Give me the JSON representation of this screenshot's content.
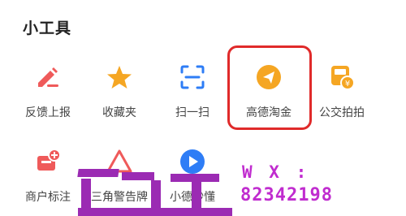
{
  "section": {
    "title": "小工具"
  },
  "tools": [
    {
      "label": "反馈上报",
      "icon": "feedback-pencil-icon"
    },
    {
      "label": "收藏夹",
      "icon": "star-icon"
    },
    {
      "label": "扫一扫",
      "icon": "scan-icon"
    },
    {
      "label": "高德淘金",
      "icon": "gold-send-icon"
    },
    {
      "label": "公交拍拍",
      "icon": "bus-camera-icon"
    },
    {
      "label": "商户标注",
      "icon": "merchant-mark-icon"
    },
    {
      "label": "三角警告牌",
      "icon": "warning-triangle-icon"
    },
    {
      "label": "小德秒懂",
      "icon": "play-circle-icon"
    }
  ],
  "watermark": {
    "line1": "W X :",
    "line2": "82342198"
  },
  "colors": {
    "accent_red": "#e94b4b",
    "accent_orange": "#f5a623",
    "accent_blue": "#2e7df6",
    "highlight_border": "#e02a2a",
    "watermark": "#c02ccf"
  }
}
